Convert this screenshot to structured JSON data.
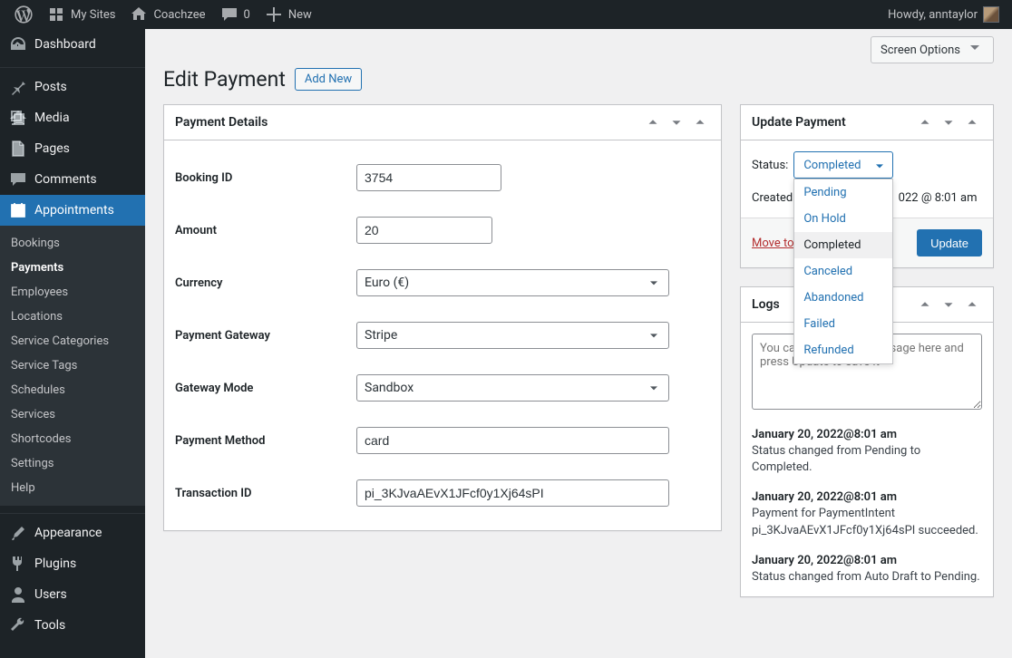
{
  "adminbar": {
    "my_sites": "My Sites",
    "site_name": "Coachzee",
    "comments_count": "0",
    "new_label": "New",
    "howdy": "Howdy, anntaylor"
  },
  "sidebar": {
    "dashboard": "Dashboard",
    "posts": "Posts",
    "media": "Media",
    "pages": "Pages",
    "comments": "Comments",
    "appointments": "Appointments",
    "submenu": {
      "bookings": "Bookings",
      "payments": "Payments",
      "employees": "Employees",
      "locations": "Locations",
      "service_categories": "Service Categories",
      "service_tags": "Service Tags",
      "schedules": "Schedules",
      "services": "Services",
      "shortcodes": "Shortcodes",
      "settings": "Settings",
      "help": "Help"
    },
    "appearance": "Appearance",
    "plugins": "Plugins",
    "users": "Users",
    "tools": "Tools"
  },
  "screen_options": "Screen Options",
  "page_title": "Edit Payment",
  "add_new": "Add New",
  "details_box": {
    "title": "Payment Details",
    "booking_id_label": "Booking ID",
    "booking_id": "3754",
    "amount_label": "Amount",
    "amount": "20",
    "currency_label": "Currency",
    "currency": "Euro (€)",
    "gateway_label": "Payment Gateway",
    "gateway": "Stripe",
    "mode_label": "Gateway Mode",
    "mode": "Sandbox",
    "method_label": "Payment Method",
    "method": "card",
    "txn_label": "Transaction ID",
    "txn": "pi_3KJvaAEvX1JFcf0y1Xj64sPI"
  },
  "update_box": {
    "title": "Update Payment",
    "status_label": "Status:",
    "status_value": "Completed",
    "status_options": [
      "Pending",
      "On Hold",
      "Completed",
      "Canceled",
      "Abandoned",
      "Failed",
      "Refunded"
    ],
    "created_prefix": "Created",
    "created_date": "022 @ 8:01 am",
    "trash": "Move to",
    "update_btn": "Update"
  },
  "logs_box": {
    "title": "Logs",
    "placeholder": "You can write a new message here and press Update to save it",
    "entries": [
      {
        "date": "January 20, 2022@8:01 am",
        "msg": "Status changed from Pending to Completed."
      },
      {
        "date": "January 20, 2022@8:01 am",
        "msg": "Payment for PaymentIntent pi_3KJvaAEvX1JFcf0y1Xj64sPI succeeded."
      },
      {
        "date": "January 20, 2022@8:01 am",
        "msg": "Status changed from Auto Draft to Pending."
      }
    ]
  }
}
